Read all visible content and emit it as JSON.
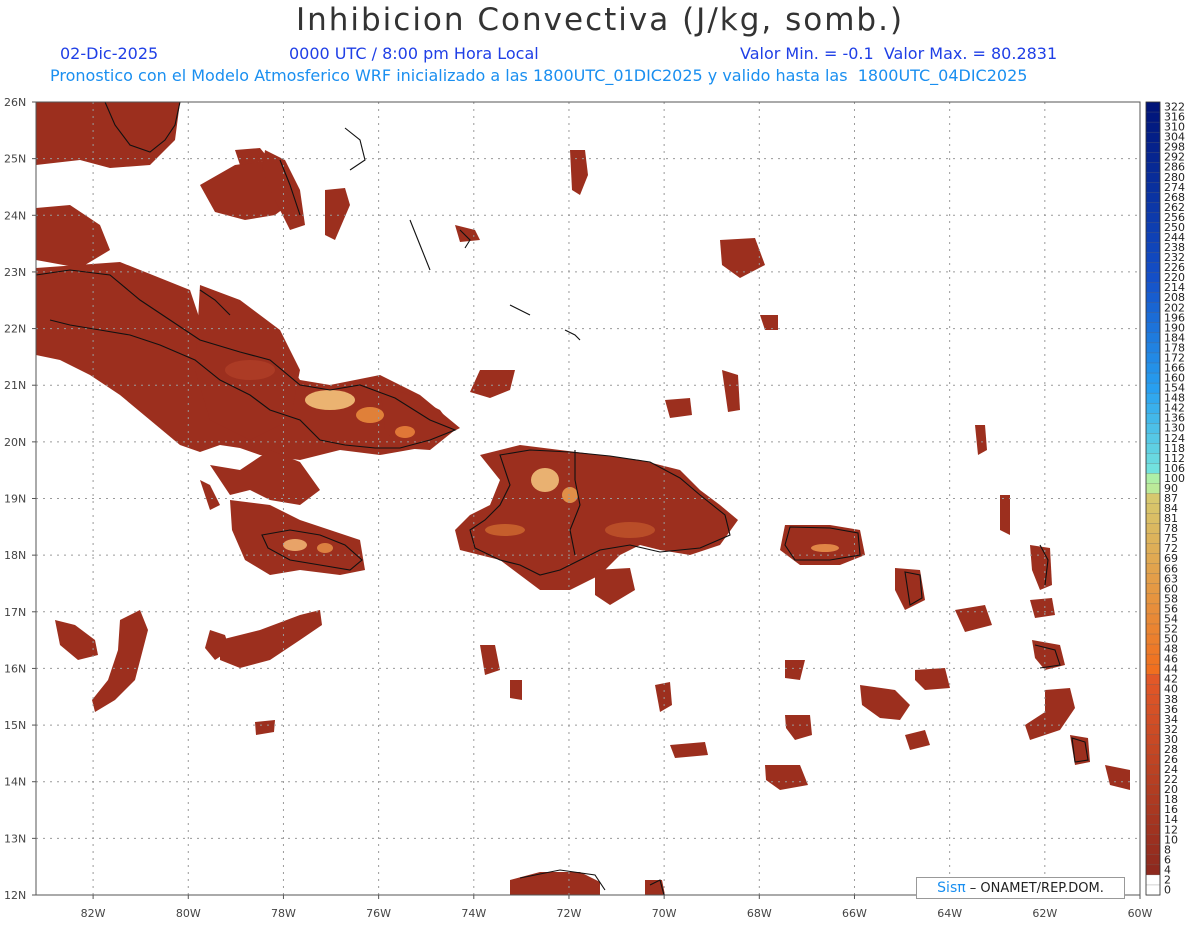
{
  "header": {
    "title": "Inhibicion Convectiva (J/kg, somb.)",
    "date": "02-Dic-2025",
    "time": "0000 UTC / 8:00 pm Hora Local",
    "minmax": "Valor Min. = -0.1  Valor Max. = 80.2831",
    "forecast": "Pronostico con el Modelo Atmosferico WRF inicializado a las 1800UTC_01DIC2025 y valido hasta las  1800UTC_04DIC2025"
  },
  "map": {
    "lat_labels": [
      "26N",
      "25N",
      "24N",
      "23N",
      "22N",
      "21N",
      "20N",
      "19N",
      "18N",
      "17N",
      "16N",
      "15N",
      "14N",
      "13N",
      "12N"
    ],
    "lon_labels": [
      "82W",
      "80W",
      "78W",
      "76W",
      "74W",
      "72W",
      "70W",
      "68W",
      "66W",
      "64W",
      "62W",
      "60W"
    ],
    "lat_range": [
      12,
      26
    ],
    "lon_range": [
      -83.2,
      -60
    ],
    "grid": true,
    "fill_color": "#9c2f1e",
    "highlight_color": "#f4c27a"
  },
  "colorbar": {
    "labels": [
      "322",
      "316",
      "310",
      "304",
      "298",
      "292",
      "286",
      "280",
      "274",
      "268",
      "262",
      "256",
      "250",
      "244",
      "238",
      "232",
      "226",
      "220",
      "214",
      "208",
      "202",
      "196",
      "190",
      "184",
      "178",
      "172",
      "166",
      "160",
      "154",
      "148",
      "142",
      "136",
      "130",
      "124",
      "118",
      "112",
      "106",
      "100",
      "90",
      "87",
      "84",
      "81",
      "78",
      "75",
      "72",
      "69",
      "66",
      "63",
      "60",
      "58",
      "56",
      "54",
      "52",
      "50",
      "48",
      "46",
      "44",
      "42",
      "40",
      "38",
      "36",
      "34",
      "32",
      "30",
      "28",
      "26",
      "24",
      "22",
      "20",
      "18",
      "16",
      "14",
      "12",
      "10",
      "8",
      "6",
      "4",
      "2",
      "0"
    ]
  },
  "credit": {
    "logo": "Sisπ",
    "text": " – ONAMET/REP.DOM."
  }
}
